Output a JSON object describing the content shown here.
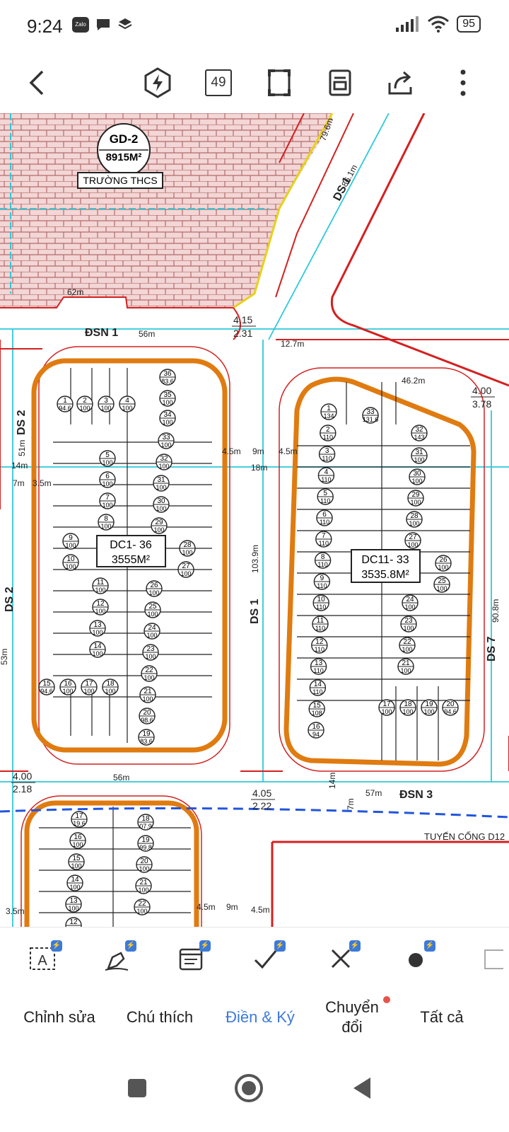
{
  "status_bar": {
    "time": "9:24",
    "notification_icons": [
      "zalo-icon",
      "chat-icon",
      "layers-icon"
    ],
    "zalo_label": "Zalo",
    "battery": "95"
  },
  "toolbar": {
    "page_count": "49"
  },
  "plan": {
    "school_code": "GD-2",
    "school_area": "8915M²",
    "school_name": "TRƯỜNG THCS",
    "block1_code": "DC1- 36",
    "block1_area": "3555M²",
    "block2_code": "DC11- 33",
    "block2_area": "3535.8M²",
    "road_ds1_top": "DS 1",
    "road_ds1_mid": "DS 1",
    "road_ds2_top": "DS 2",
    "road_ds2_mid": "DS 2",
    "road_ds7": "DS 7",
    "road_dsn1": "ĐSN 1",
    "road_dsn3": "ĐSN 3",
    "culvert": "TUYẾN CỐNG D12",
    "dim_86": "86.1m",
    "dim_56a": "56m",
    "dim_56b": "56m",
    "dim_57": "57m",
    "dim_46": "46.2m",
    "dim_1039": "103.9m",
    "dim_908": "90.8m",
    "dim_127": "12.7m",
    "dim_18": "18m",
    "dim_9a": "9m",
    "dim_45a": "4.5m",
    "dim_45b": "4.5m",
    "dim_14a": "14m",
    "dim_14b": "14m",
    "dim_7a": "7m",
    "dim_7b": "7m",
    "dim_35": "3.5m",
    "dim_51": "51m",
    "dim_53": "53m",
    "dim_62": "62m",
    "dim_796": "79.6m",
    "dim_9b": "9m",
    "dim_45c": "4.5m",
    "dim_45d": "4.5m",
    "dim_35b": "3.5m",
    "elev_1": "4.15",
    "elev_2": "2.31",
    "elev_3": "4.00",
    "elev_4": "3.78",
    "elev_5": "4.00",
    "elev_6": "2.18",
    "elev_7": "4.05",
    "elev_8": "2.22"
  },
  "lots_block1_left": [
    {
      "n": "1",
      "a": "94.6"
    },
    {
      "n": "2",
      "a": "100"
    },
    {
      "n": "3",
      "a": "100"
    },
    {
      "n": "4",
      "a": "100"
    },
    {
      "n": "5",
      "a": "100"
    },
    {
      "n": "6",
      "a": "100"
    },
    {
      "n": "7",
      "a": "100"
    },
    {
      "n": "8",
      "a": "100"
    },
    {
      "n": "9",
      "a": "100"
    },
    {
      "n": "10",
      "a": "100"
    },
    {
      "n": "11",
      "a": "100"
    },
    {
      "n": "12",
      "a": "100"
    },
    {
      "n": "13",
      "a": "100"
    },
    {
      "n": "14",
      "a": "100"
    },
    {
      "n": "15",
      "a": "94.6"
    },
    {
      "n": "16",
      "a": "100"
    },
    {
      "n": "17",
      "a": "100"
    },
    {
      "n": "18",
      "a": "100"
    }
  ],
  "lots_block1_right": [
    {
      "n": "36",
      "a": "83.6"
    },
    {
      "n": "35",
      "a": "100"
    },
    {
      "n": "34",
      "a": "100"
    },
    {
      "n": "33",
      "a": "100"
    },
    {
      "n": "32",
      "a": "100"
    },
    {
      "n": "31",
      "a": "100"
    },
    {
      "n": "30",
      "a": "100"
    },
    {
      "n": "29",
      "a": "100"
    },
    {
      "n": "28",
      "a": "100"
    },
    {
      "n": "27",
      "a": "100"
    },
    {
      "n": "26",
      "a": "100"
    },
    {
      "n": "25",
      "a": "100"
    },
    {
      "n": "24",
      "a": "100"
    },
    {
      "n": "23",
      "a": "100"
    },
    {
      "n": "22",
      "a": "100"
    },
    {
      "n": "21",
      "a": "100"
    },
    {
      "n": "20",
      "a": "98.6"
    },
    {
      "n": "19",
      "a": "83.6"
    }
  ],
  "lots_block2_left": [
    {
      "n": "1",
      "a": "134"
    },
    {
      "n": "2",
      "a": "110"
    },
    {
      "n": "3",
      "a": "110"
    },
    {
      "n": "4",
      "a": "110"
    },
    {
      "n": "5",
      "a": "110"
    },
    {
      "n": "6",
      "a": "110"
    },
    {
      "n": "7",
      "a": "110"
    },
    {
      "n": "8",
      "a": "110"
    },
    {
      "n": "9",
      "a": "110"
    },
    {
      "n": "10",
      "a": "110"
    },
    {
      "n": "11",
      "a": "110"
    },
    {
      "n": "12",
      "a": "110"
    },
    {
      "n": "13",
      "a": "110"
    },
    {
      "n": "14",
      "a": "110"
    },
    {
      "n": "15",
      "a": "108"
    },
    {
      "n": "16",
      "a": "94"
    }
  ],
  "lots_block2_right": [
    {
      "n": "33",
      "a": "131.6"
    },
    {
      "n": "32",
      "a": "143"
    },
    {
      "n": "31",
      "a": "100"
    },
    {
      "n": "30",
      "a": "100"
    },
    {
      "n": "29",
      "a": "100"
    },
    {
      "n": "28",
      "a": "100"
    },
    {
      "n": "27",
      "a": "100"
    },
    {
      "n": "26",
      "a": "100"
    },
    {
      "n": "25",
      "a": "100"
    },
    {
      "n": "24",
      "a": "100"
    },
    {
      "n": "23",
      "a": "100"
    },
    {
      "n": "22",
      "a": "100"
    },
    {
      "n": "21",
      "a": "100"
    },
    {
      "n": "20",
      "a": "94.6"
    },
    {
      "n": "19",
      "a": "100"
    },
    {
      "n": "18",
      "a": "100"
    },
    {
      "n": "17",
      "a": "100"
    }
  ],
  "lots_block3": [
    {
      "n": "17",
      "a": "19.6"
    },
    {
      "n": "16",
      "a": "100"
    },
    {
      "n": "15",
      "a": "100"
    },
    {
      "n": "14",
      "a": "100"
    },
    {
      "n": "13",
      "a": "100"
    },
    {
      "n": "12",
      "a": ""
    },
    {
      "n": "18",
      "a": "07.9"
    },
    {
      "n": "19",
      "a": "99.8"
    },
    {
      "n": "20",
      "a": "100"
    },
    {
      "n": "21",
      "a": "100"
    },
    {
      "n": "22",
      "a": "100"
    }
  ],
  "bottom_tabs": [
    {
      "label": "Chỉnh sửa",
      "active": false
    },
    {
      "label": "Chú thích",
      "active": false
    },
    {
      "label": "Điền & Ký",
      "active": true
    },
    {
      "label": "Chuyển đổi",
      "active": false
    },
    {
      "label": "Tất cả",
      "active": false
    }
  ],
  "tools": [
    "text-field-icon",
    "signature-icon",
    "date-icon",
    "checkmark-icon",
    "cross-icon",
    "dot-icon"
  ],
  "colors": {
    "accent": "#3d7ad8",
    "lot_border": "#e07b10",
    "road_red": "#d42020",
    "road_cyan": "#2ec9d8",
    "school_fill": "#f3d6d6"
  }
}
